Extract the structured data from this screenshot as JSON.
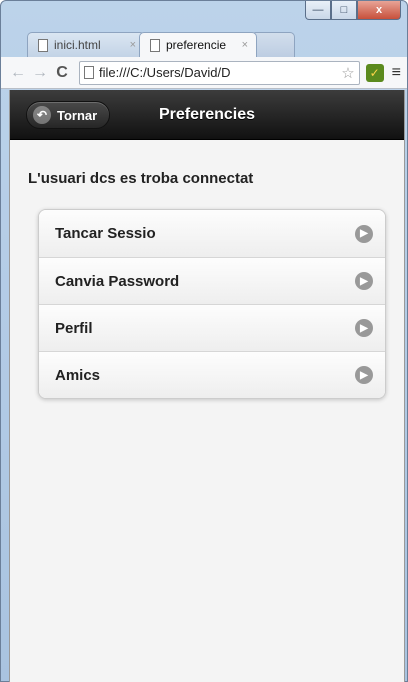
{
  "browser": {
    "tabs": [
      {
        "label": "inici.html",
        "close": "×"
      },
      {
        "label": "preferencie",
        "close": "×"
      }
    ],
    "address": "file:///C:/Users/David/D",
    "window_controls": {
      "minimize": "—",
      "maximize": "□",
      "close": "x"
    },
    "nav": {
      "back": "←",
      "forward": "→",
      "reload": "C"
    },
    "star": "☆",
    "menu": "≡"
  },
  "header": {
    "back_label": "Tornar",
    "title": "Preferencies"
  },
  "main": {
    "status": "L'usuari dcs es troba connectat",
    "items": [
      {
        "label": "Tancar Sessio"
      },
      {
        "label": "Canvia Password"
      },
      {
        "label": "Perfil"
      },
      {
        "label": "Amics"
      }
    ]
  },
  "colors": {
    "header_bg": "#1e1e1e",
    "list_bg": "#f6f6f6",
    "arrow": "#999999"
  },
  "icons": [
    "back-arrow-icon",
    "chevron-right-icon",
    "document-icon",
    "star-icon",
    "menu-icon"
  ]
}
